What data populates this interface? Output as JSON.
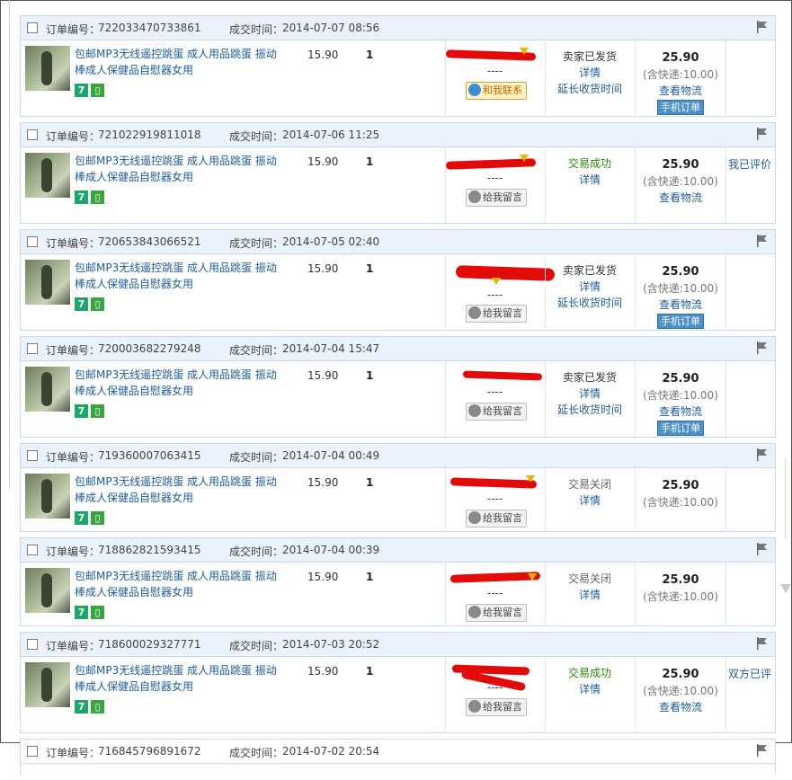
{
  "labels": {
    "order_no": "订单编号：",
    "deal_time": "成交时间：",
    "dashes": "----",
    "contact_me": "和我联系",
    "leave_msg": "给我留言",
    "details": "详情",
    "extend": "延长收货时间",
    "view_logistics": "查看物流",
    "mobile_order": "手机订单"
  },
  "orders": [
    {
      "no": "722033470733861",
      "time": "2014-07-07 08:56",
      "title": "包邮MP3无线遥控跳蛋 成人用品跳蛋 振动棒成人保健品自慰器女用",
      "price": "15.90",
      "qty": "1",
      "status": "卖家已发货",
      "total": "25.90",
      "shipping": "(含快递:10.00)",
      "review": ""
    },
    {
      "no": "721022919811018",
      "time": "2014-07-06 11:25",
      "title": "包邮MP3无线遥控跳蛋 成人用品跳蛋 振动棒成人保健品自慰器女用",
      "price": "15.90",
      "qty": "1",
      "status": "交易成功",
      "total": "25.90",
      "shipping": "(含快递:10.00)",
      "review": "我已评价"
    },
    {
      "no": "720653843066521",
      "time": "2014-07-05 02:40",
      "title": "包邮MP3无线遥控跳蛋 成人用品跳蛋 振动棒成人保健品自慰器女用",
      "price": "15.90",
      "qty": "1",
      "status": "卖家已发货",
      "total": "25.90",
      "shipping": "(含快递:10.00)",
      "review": ""
    },
    {
      "no": "720003682279248",
      "time": "2014-07-04 15:47",
      "title": "包邮MP3无线遥控跳蛋 成人用品跳蛋 振动棒成人保健品自慰器女用",
      "price": "15.90",
      "qty": "1",
      "status": "卖家已发货",
      "total": "25.90",
      "shipping": "(含快递:10.00)",
      "review": ""
    },
    {
      "no": "719360007063415",
      "time": "2014-07-04 00:49",
      "title": "包邮MP3无线遥控跳蛋 成人用品跳蛋 振动棒成人保健品自慰器女用",
      "price": "15.90",
      "qty": "1",
      "status": "交易关闭",
      "total": "25.90",
      "shipping": "(含快递:10.00)",
      "review": ""
    },
    {
      "no": "718862821593415",
      "time": "2014-07-04 00:39",
      "title": "包邮MP3无线遥控跳蛋 成人用品跳蛋 振动棒成人保健品自慰器女用",
      "price": "15.90",
      "qty": "1",
      "status": "交易关闭",
      "total": "25.90",
      "shipping": "(含快递:10.00)",
      "review": ""
    },
    {
      "no": "718600029327771",
      "time": "2014-07-03 20:52",
      "title": "包邮MP3无线遥控跳蛋 成人用品跳蛋 振动棒成人保健品自慰器女用",
      "price": "15.90",
      "qty": "1",
      "status": "交易成功",
      "total": "25.90",
      "shipping": "(含快递:10.00)",
      "review": "双方已评"
    },
    {
      "no": "716845796891672",
      "time": "2014-07-02 20:54"
    }
  ],
  "icons": {
    "checkbox": "checkbox-icon",
    "flag": "flag-icon",
    "t7": "seven-day-return-icon",
    "mobile": "mobile-purchase-icon",
    "wangwang": "wangwang-chat-icon"
  },
  "colors": {
    "header_bg": "#eaf2fb",
    "border": "#c6d9ee",
    "link": "#1d5c9a",
    "success": "#2a8a00",
    "redaction": "#e30a0a"
  }
}
